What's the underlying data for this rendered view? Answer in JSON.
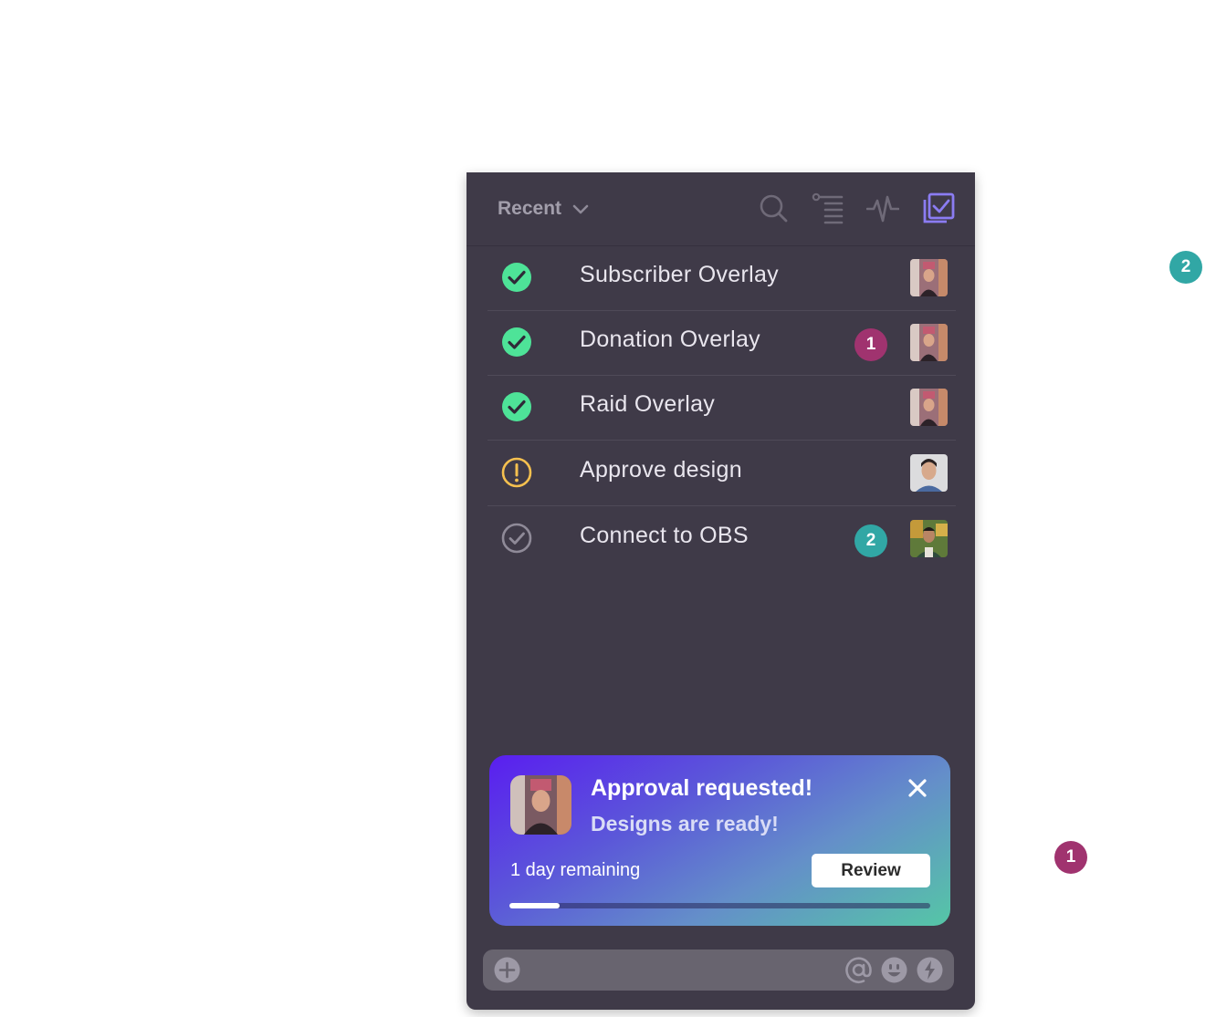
{
  "header": {
    "filter_label": "Recent",
    "icons": [
      "search-icon",
      "tree-list-icon",
      "activity-icon",
      "checklist-icon"
    ]
  },
  "tasks": [
    {
      "label": "Subscriber Overlay",
      "status": "done",
      "badge": null,
      "avatar": "woman-avatar"
    },
    {
      "label": "Donation Overlay",
      "status": "done",
      "badge": "1",
      "badge_color": "#a0336f",
      "avatar": "woman-avatar"
    },
    {
      "label": "Raid Overlay",
      "status": "done",
      "badge": null,
      "avatar": "woman-avatar"
    },
    {
      "label": "Approve design",
      "status": "warning",
      "badge": null,
      "avatar": "man-avatar"
    },
    {
      "label": "Connect to OBS",
      "status": "pending",
      "badge": "2",
      "badge_color": "#31a7a5",
      "avatar": "man-outdoor-avatar"
    }
  ],
  "toast": {
    "title": "Approval requested!",
    "subtitle": "Designs are ready!",
    "remaining": "1 day remaining",
    "review_label": "Review",
    "progress": 0.12
  },
  "composer": {
    "placeholder": "",
    "icons": [
      "add-icon",
      "mention-icon",
      "emoji-icon",
      "attachment-icon"
    ]
  },
  "floating_badges": [
    {
      "value": "2",
      "color": "#31a7a5"
    },
    {
      "value": "1",
      "color": "#a0336f"
    }
  ],
  "colors": {
    "panel": "#3f3a48",
    "done": "#4ee398",
    "warning": "#f5c04f",
    "pending": "#8f8a98",
    "accent": "#8b7cf2"
  }
}
